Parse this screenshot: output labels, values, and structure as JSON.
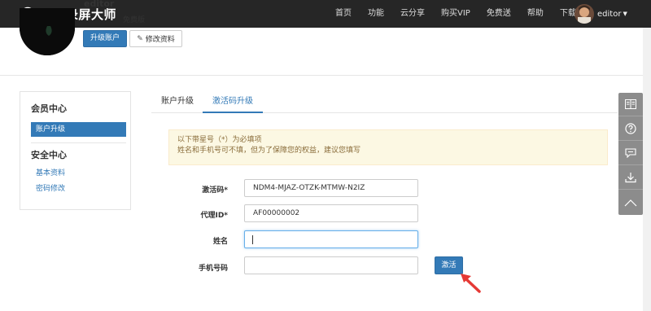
{
  "brand": {
    "name": "万彩录屏大师"
  },
  "nav": {
    "items": [
      "首页",
      "功能",
      "云分享",
      "购买VIP",
      "免费送",
      "帮助",
      "下载"
    ],
    "username": "editor"
  },
  "profile": {
    "username": "editor",
    "plan": "免费版",
    "upgrade_label": "升级账户",
    "edit_label": "修改资料"
  },
  "sidebar": {
    "member_center": "会员中心",
    "account_upgrade": "账户升级",
    "security_center": "安全中心",
    "basic_info": "基本资料",
    "password_change": "密码修改"
  },
  "tabs": {
    "upgrade": "账户升级",
    "activation": "激活码升级"
  },
  "notice": {
    "line1": "以下带星号（*）为必填项",
    "line2": "姓名和手机号可不填，但为了保障您的权益，建议您填写"
  },
  "form": {
    "code_label": "激活码*",
    "code_value": "NDM4-MJAZ-OTZK-MTMW-N2IZ",
    "agent_label": "代理ID*",
    "agent_value": "AF00000002",
    "name_label": "姓名",
    "name_value": "",
    "phone_label": "手机号码",
    "phone_value": "",
    "activate_label": "激活"
  },
  "colors": {
    "primary": "#337ab7",
    "navbar": "#262626",
    "arrow": "#e53935"
  }
}
